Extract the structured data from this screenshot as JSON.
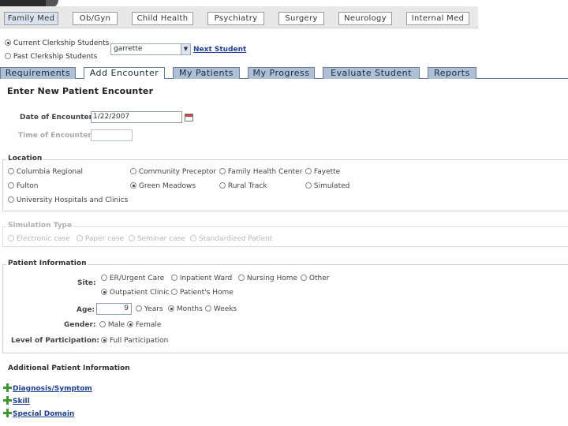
{
  "disciplines": [
    {
      "label": "Family Med",
      "active": true
    },
    {
      "label": "Ob/Gyn",
      "active": false
    },
    {
      "label": "Child Health",
      "active": false
    },
    {
      "label": "Psychiatry",
      "active": false
    },
    {
      "label": "Surgery",
      "active": false
    },
    {
      "label": "Neurology",
      "active": false
    },
    {
      "label": "Internal Med",
      "active": false
    }
  ],
  "student_selector": {
    "current_label": "Current Clerkship Students",
    "past_label": "Past Clerkship Students",
    "selected_student": "garrette",
    "next_student_label": "Next Student"
  },
  "nav_tabs": [
    {
      "label": "Requirements",
      "active": false
    },
    {
      "label": "Add Encounter",
      "active": true
    },
    {
      "label": "My Patients",
      "active": false
    },
    {
      "label": "My Progress",
      "active": false
    },
    {
      "label": "Evaluate Student",
      "active": false
    },
    {
      "label": "Reports",
      "active": false
    }
  ],
  "page_title": "Enter New Patient Encounter",
  "encounter": {
    "date_label": "Date of Encounter:",
    "date_value": "1/22/2007",
    "time_label": "Time of Encounter:",
    "time_value": ""
  },
  "location": {
    "legend": "Location",
    "options": [
      {
        "label": "Columbia Regional",
        "selected": false
      },
      {
        "label": "Community Preceptor",
        "selected": false
      },
      {
        "label": "Family Health Center",
        "selected": false
      },
      {
        "label": "Fayette",
        "selected": false
      },
      {
        "label": "Fulton",
        "selected": false
      },
      {
        "label": "Green Meadows",
        "selected": true
      },
      {
        "label": "Rural Track",
        "selected": false
      },
      {
        "label": "Simulated",
        "selected": false
      },
      {
        "label": "University Hospitals and Clinics",
        "selected": false
      }
    ]
  },
  "simulation": {
    "legend": "Simulation Type",
    "options": [
      {
        "label": "Electronic case"
      },
      {
        "label": "Paper case"
      },
      {
        "label": "Seminar case"
      },
      {
        "label": "Standardized Patient"
      }
    ]
  },
  "patient_info": {
    "legend": "Patient Information",
    "site_label": "Site:",
    "site_options": [
      {
        "label": "ER/Urgent Care",
        "selected": false
      },
      {
        "label": "Inpatient Ward",
        "selected": false
      },
      {
        "label": "Nursing Home",
        "selected": false
      },
      {
        "label": "Other",
        "selected": false
      },
      {
        "label": "Outpatient Clinic",
        "selected": true
      },
      {
        "label": "Patient's Home",
        "selected": false
      }
    ],
    "age_label": "Age:",
    "age_value": "9",
    "age_units": [
      {
        "label": "Years",
        "selected": false
      },
      {
        "label": "Months",
        "selected": true
      },
      {
        "label": "Weeks",
        "selected": false
      }
    ],
    "gender_label": "Gender:",
    "gender_options": [
      {
        "label": "Male",
        "selected": false
      },
      {
        "label": "Female",
        "selected": true
      }
    ],
    "participation_label": "Level of Participation:",
    "participation_options": [
      {
        "label": "Full Participation",
        "selected": true
      }
    ]
  },
  "additional": {
    "heading": "Additional Patient Information",
    "links": [
      {
        "label": "Diagnosis/Symptom"
      },
      {
        "label": "Skill"
      },
      {
        "label": "Special Domain"
      }
    ]
  }
}
